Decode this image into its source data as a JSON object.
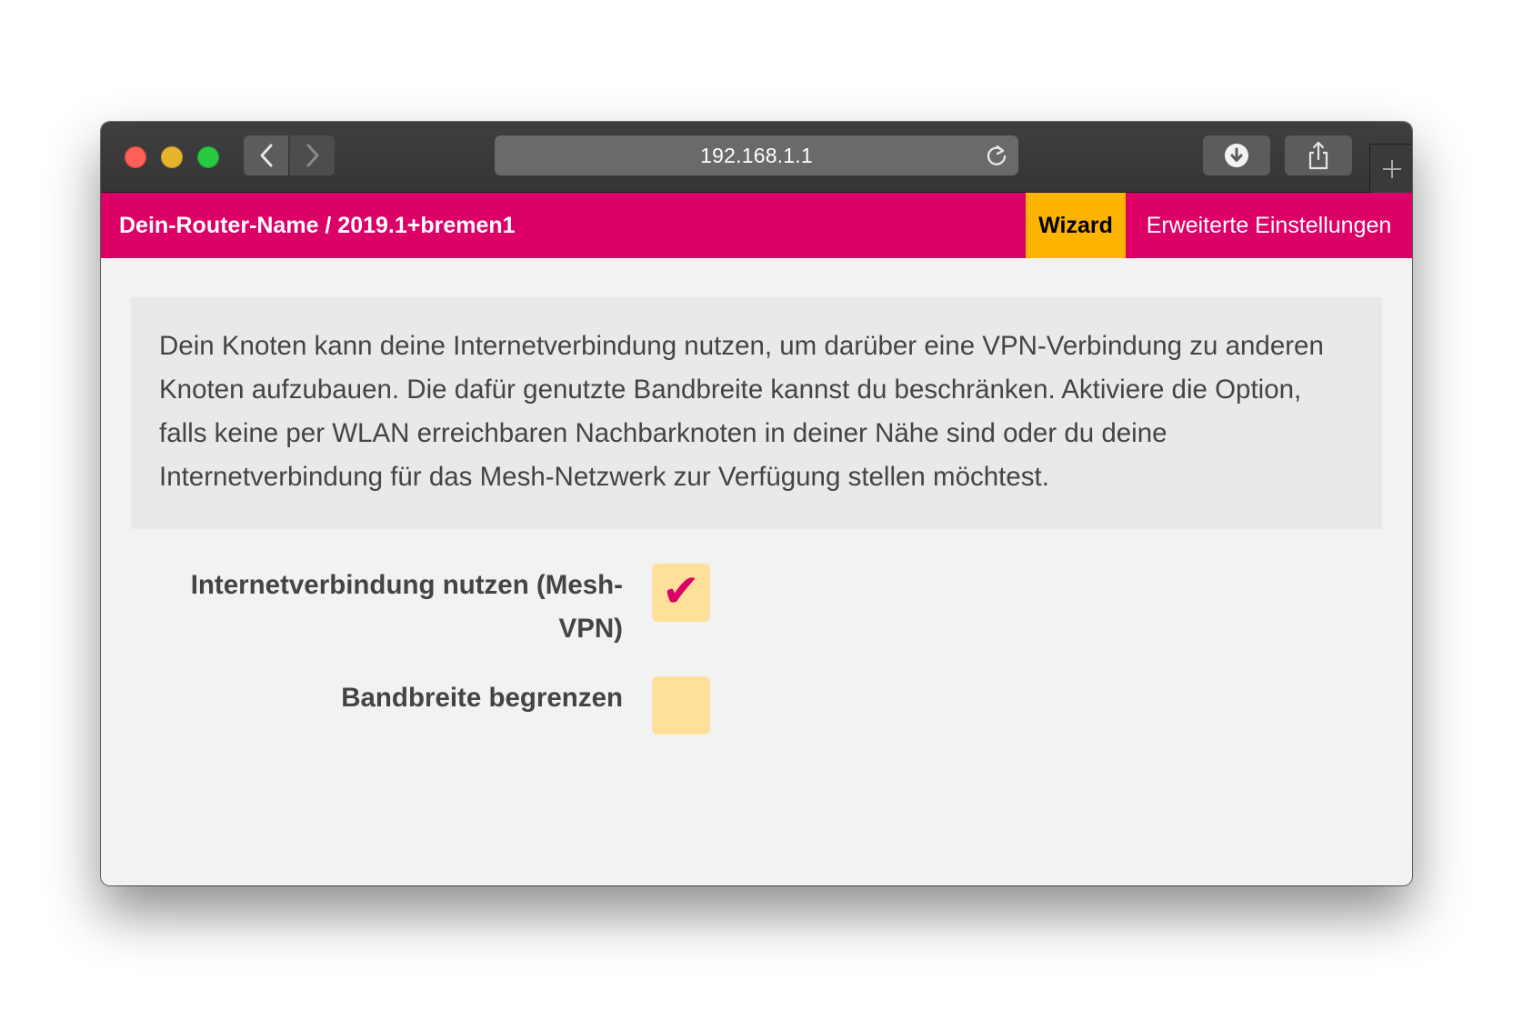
{
  "browser": {
    "url": "192.168.1.1"
  },
  "header": {
    "router_name": "Dein-Router-Name / 2019.1+bremen1",
    "tabs": [
      {
        "label": "Wizard",
        "active": true
      },
      {
        "label": "Erweiterte Einstellungen",
        "active": false
      }
    ]
  },
  "info": {
    "text": "Dein Knoten kann deine Internetverbindung nutzen, um darüber eine VPN-Verbindung zu anderen Knoten aufzubauen. Die dafür genutzte Bandbreite kannst du beschränken. Aktiviere die Option, falls keine per WLAN erreichbaren Nachbarknoten in deiner Nähe sind oder du deine Internetverbindung für das Mesh-Netzwerk zur Verfügung stellen möchtest."
  },
  "form": {
    "mesh_vpn": {
      "label": "Internetverbindung nutzen (Mesh-VPN)",
      "checked": true,
      "check_glyph": "✔"
    },
    "limit_bandwidth": {
      "label": "Bandbreite begrenzen",
      "checked": false
    }
  },
  "colors": {
    "header_bg": "#dc0067",
    "active_tab_bg": "#ffb400",
    "checkbox_bg": "#ffe09a",
    "check_color": "#dc0067"
  }
}
